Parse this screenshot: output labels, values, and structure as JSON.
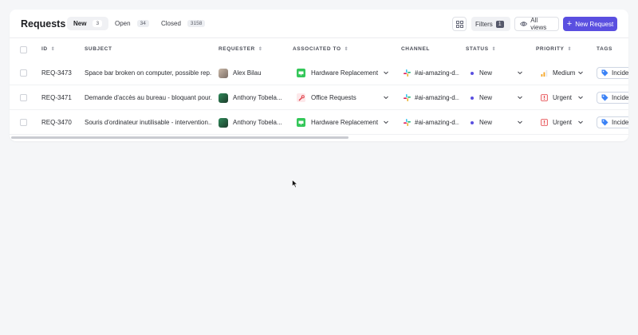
{
  "header": {
    "title": "Requests",
    "tabs": [
      {
        "label": "New",
        "count": "3"
      },
      {
        "label": "Open",
        "count": "34"
      },
      {
        "label": "Closed",
        "count": "3158"
      }
    ],
    "filters_label": "Filters",
    "filters_count": "1",
    "views_label": "All views",
    "new_request_label": "New Request"
  },
  "columns": {
    "id": "ID",
    "subject": "SUBJECT",
    "requester": "REQUESTER",
    "associated": "ASSOCIATED TO",
    "channel": "CHANNEL",
    "status": "STATUS",
    "priority": "PRIORITY",
    "tags": "TAGS"
  },
  "rows": [
    {
      "id": "REQ-3473",
      "subject": "Space bar broken on computer, possible rep...",
      "requester": "Alex Bilau",
      "associated": "Hardware Replacement",
      "channel": "#ai-amazing-d...",
      "status": "New",
      "priority": "Medium",
      "tag": "Incide"
    },
    {
      "id": "REQ-3471",
      "subject": "Demande d'accès au bureau - bloquant pour...",
      "requester": "Anthony Tobela...",
      "associated": "Office Requests",
      "channel": "#ai-amazing-d...",
      "status": "New",
      "priority": "Urgent",
      "tag": "Incide"
    },
    {
      "id": "REQ-3470",
      "subject": "Souris d'ordinateur inutilisable - intervention...",
      "requester": "Anthony Tobela...",
      "associated": "Hardware Replacement",
      "channel": "#ai-amazing-d...",
      "status": "New",
      "priority": "Urgent",
      "tag": "Incide"
    }
  ],
  "colors": {
    "accent": "#5a4fe0",
    "hardware_icon": "#34c759",
    "office_icon": "#e0424b",
    "urgent": "#e5484d",
    "medium": "#f5a524",
    "tag_icon": "#3b82f6"
  },
  "icons": {
    "grid": "grid-icon",
    "views": "eye-icon",
    "channel": "slack-icon",
    "tag": "tag-icon",
    "hardware": "monitor-icon",
    "office": "tools-icon",
    "urgent": "alert-icon",
    "medium": "signal-bars-icon"
  }
}
